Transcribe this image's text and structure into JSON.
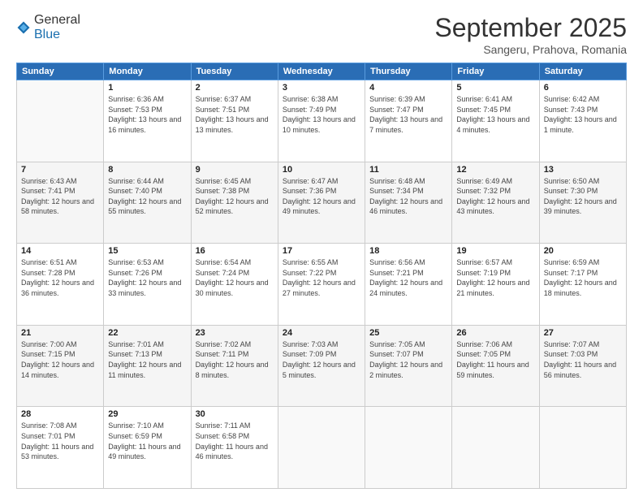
{
  "logo": {
    "general": "General",
    "blue": "Blue"
  },
  "header": {
    "month": "September 2025",
    "location": "Sangeru, Prahova, Romania"
  },
  "weekdays": [
    "Sunday",
    "Monday",
    "Tuesday",
    "Wednesday",
    "Thursday",
    "Friday",
    "Saturday"
  ],
  "weeks": [
    [
      {
        "day": "",
        "sunrise": "",
        "sunset": "",
        "daylight": ""
      },
      {
        "day": "1",
        "sunrise": "Sunrise: 6:36 AM",
        "sunset": "Sunset: 7:53 PM",
        "daylight": "Daylight: 13 hours and 16 minutes."
      },
      {
        "day": "2",
        "sunrise": "Sunrise: 6:37 AM",
        "sunset": "Sunset: 7:51 PM",
        "daylight": "Daylight: 13 hours and 13 minutes."
      },
      {
        "day": "3",
        "sunrise": "Sunrise: 6:38 AM",
        "sunset": "Sunset: 7:49 PM",
        "daylight": "Daylight: 13 hours and 10 minutes."
      },
      {
        "day": "4",
        "sunrise": "Sunrise: 6:39 AM",
        "sunset": "Sunset: 7:47 PM",
        "daylight": "Daylight: 13 hours and 7 minutes."
      },
      {
        "day": "5",
        "sunrise": "Sunrise: 6:41 AM",
        "sunset": "Sunset: 7:45 PM",
        "daylight": "Daylight: 13 hours and 4 minutes."
      },
      {
        "day": "6",
        "sunrise": "Sunrise: 6:42 AM",
        "sunset": "Sunset: 7:43 PM",
        "daylight": "Daylight: 13 hours and 1 minute."
      }
    ],
    [
      {
        "day": "7",
        "sunrise": "Sunrise: 6:43 AM",
        "sunset": "Sunset: 7:41 PM",
        "daylight": "Daylight: 12 hours and 58 minutes."
      },
      {
        "day": "8",
        "sunrise": "Sunrise: 6:44 AM",
        "sunset": "Sunset: 7:40 PM",
        "daylight": "Daylight: 12 hours and 55 minutes."
      },
      {
        "day": "9",
        "sunrise": "Sunrise: 6:45 AM",
        "sunset": "Sunset: 7:38 PM",
        "daylight": "Daylight: 12 hours and 52 minutes."
      },
      {
        "day": "10",
        "sunrise": "Sunrise: 6:47 AM",
        "sunset": "Sunset: 7:36 PM",
        "daylight": "Daylight: 12 hours and 49 minutes."
      },
      {
        "day": "11",
        "sunrise": "Sunrise: 6:48 AM",
        "sunset": "Sunset: 7:34 PM",
        "daylight": "Daylight: 12 hours and 46 minutes."
      },
      {
        "day": "12",
        "sunrise": "Sunrise: 6:49 AM",
        "sunset": "Sunset: 7:32 PM",
        "daylight": "Daylight: 12 hours and 43 minutes."
      },
      {
        "day": "13",
        "sunrise": "Sunrise: 6:50 AM",
        "sunset": "Sunset: 7:30 PM",
        "daylight": "Daylight: 12 hours and 39 minutes."
      }
    ],
    [
      {
        "day": "14",
        "sunrise": "Sunrise: 6:51 AM",
        "sunset": "Sunset: 7:28 PM",
        "daylight": "Daylight: 12 hours and 36 minutes."
      },
      {
        "day": "15",
        "sunrise": "Sunrise: 6:53 AM",
        "sunset": "Sunset: 7:26 PM",
        "daylight": "Daylight: 12 hours and 33 minutes."
      },
      {
        "day": "16",
        "sunrise": "Sunrise: 6:54 AM",
        "sunset": "Sunset: 7:24 PM",
        "daylight": "Daylight: 12 hours and 30 minutes."
      },
      {
        "day": "17",
        "sunrise": "Sunrise: 6:55 AM",
        "sunset": "Sunset: 7:22 PM",
        "daylight": "Daylight: 12 hours and 27 minutes."
      },
      {
        "day": "18",
        "sunrise": "Sunrise: 6:56 AM",
        "sunset": "Sunset: 7:21 PM",
        "daylight": "Daylight: 12 hours and 24 minutes."
      },
      {
        "day": "19",
        "sunrise": "Sunrise: 6:57 AM",
        "sunset": "Sunset: 7:19 PM",
        "daylight": "Daylight: 12 hours and 21 minutes."
      },
      {
        "day": "20",
        "sunrise": "Sunrise: 6:59 AM",
        "sunset": "Sunset: 7:17 PM",
        "daylight": "Daylight: 12 hours and 18 minutes."
      }
    ],
    [
      {
        "day": "21",
        "sunrise": "Sunrise: 7:00 AM",
        "sunset": "Sunset: 7:15 PM",
        "daylight": "Daylight: 12 hours and 14 minutes."
      },
      {
        "day": "22",
        "sunrise": "Sunrise: 7:01 AM",
        "sunset": "Sunset: 7:13 PM",
        "daylight": "Daylight: 12 hours and 11 minutes."
      },
      {
        "day": "23",
        "sunrise": "Sunrise: 7:02 AM",
        "sunset": "Sunset: 7:11 PM",
        "daylight": "Daylight: 12 hours and 8 minutes."
      },
      {
        "day": "24",
        "sunrise": "Sunrise: 7:03 AM",
        "sunset": "Sunset: 7:09 PM",
        "daylight": "Daylight: 12 hours and 5 minutes."
      },
      {
        "day": "25",
        "sunrise": "Sunrise: 7:05 AM",
        "sunset": "Sunset: 7:07 PM",
        "daylight": "Daylight: 12 hours and 2 minutes."
      },
      {
        "day": "26",
        "sunrise": "Sunrise: 7:06 AM",
        "sunset": "Sunset: 7:05 PM",
        "daylight": "Daylight: 11 hours and 59 minutes."
      },
      {
        "day": "27",
        "sunrise": "Sunrise: 7:07 AM",
        "sunset": "Sunset: 7:03 PM",
        "daylight": "Daylight: 11 hours and 56 minutes."
      }
    ],
    [
      {
        "day": "28",
        "sunrise": "Sunrise: 7:08 AM",
        "sunset": "Sunset: 7:01 PM",
        "daylight": "Daylight: 11 hours and 53 minutes."
      },
      {
        "day": "29",
        "sunrise": "Sunrise: 7:10 AM",
        "sunset": "Sunset: 6:59 PM",
        "daylight": "Daylight: 11 hours and 49 minutes."
      },
      {
        "day": "30",
        "sunrise": "Sunrise: 7:11 AM",
        "sunset": "Sunset: 6:58 PM",
        "daylight": "Daylight: 11 hours and 46 minutes."
      },
      {
        "day": "",
        "sunrise": "",
        "sunset": "",
        "daylight": ""
      },
      {
        "day": "",
        "sunrise": "",
        "sunset": "",
        "daylight": ""
      },
      {
        "day": "",
        "sunrise": "",
        "sunset": "",
        "daylight": ""
      },
      {
        "day": "",
        "sunrise": "",
        "sunset": "",
        "daylight": ""
      }
    ]
  ]
}
